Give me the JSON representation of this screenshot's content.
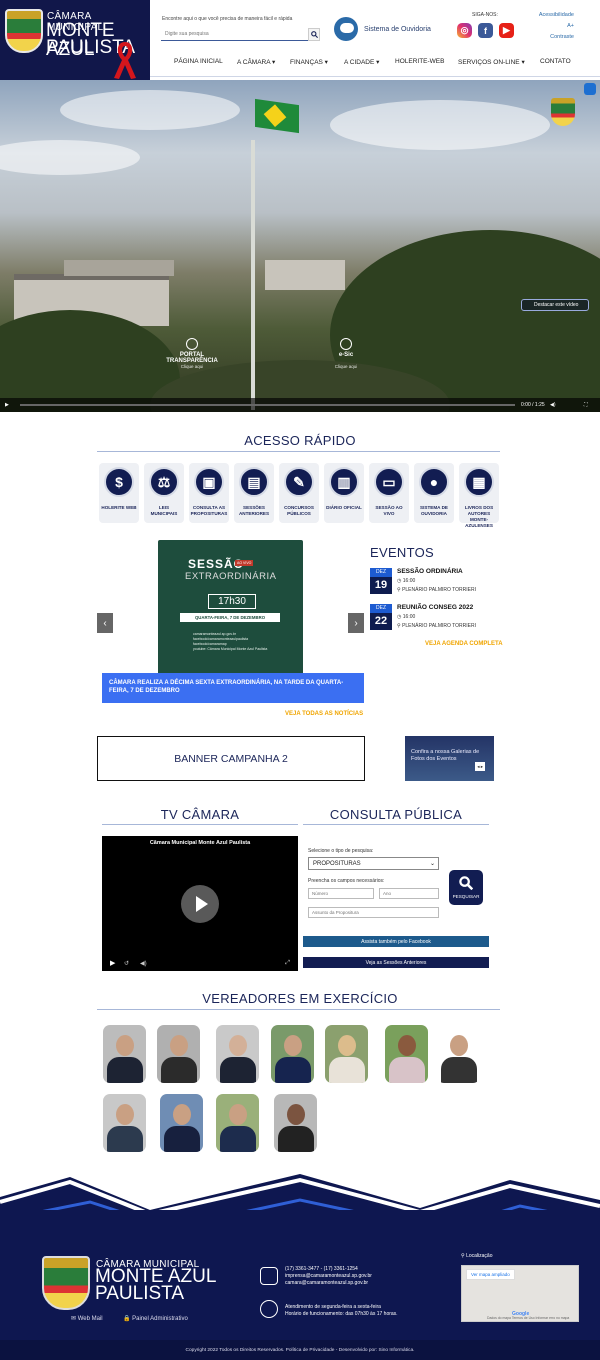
{
  "header": {
    "logo": {
      "line1": "CÂMARA MUNICIPAL",
      "line2": "MONTE AZUL",
      "line3": "PAULISTA"
    },
    "search": {
      "hint": "Encontre aqui o que você precisa de maneira fácil e rápida",
      "placeholder": "Digite sua pesquisa"
    },
    "ouvidoria": "Sistema de Ouvidoria",
    "siga": "SIGA-NOS:",
    "accessibility": {
      "acessibilidade": "Acessibilidade",
      "font_plus": "A+",
      "contraste": "Contraste"
    },
    "nav": [
      "PÁGINA INICIAL",
      "A CÂMARA ▾",
      "FINANÇAS ▾",
      "A CIDADE ▾",
      "HOLERITE-WEB",
      "SERVIÇOS ON-LINE ▾",
      "CONTATO"
    ]
  },
  "hero": {
    "destacar": "Destacar este vídeo",
    "portal": {
      "title1": "PORTAL",
      "title2": "TRANSPARÊNCIA",
      "sub": "Clique aqui"
    },
    "esic": {
      "title": "e-Sic",
      "sub": "Clique aqui"
    },
    "time": "0:00 / 1:25"
  },
  "acesso": {
    "title": "ACESSO RÁPIDO",
    "items": [
      {
        "label": "HOLERITE WEB",
        "icon": "$"
      },
      {
        "label": "LEIS MUNICIPAIS",
        "icon": "⚖"
      },
      {
        "label": "CONSULTA AS PROPOSITURAS",
        "icon": "▣"
      },
      {
        "label": "SESSÕES ANTERIORES",
        "icon": "▤"
      },
      {
        "label": "CONCURSOS PÚBLICOS",
        "icon": "✎"
      },
      {
        "label": "DIÁRIO OFICIAL",
        "icon": "▥"
      },
      {
        "label": "SESSÃO AO VIVO",
        "icon": "▭"
      },
      {
        "label": "SISTEMA DE OUVIDORIA",
        "icon": "●"
      },
      {
        "label": "LIVROS DOS AUTORES MONTE-AZULENSES",
        "icon": "▦"
      }
    ]
  },
  "noticia": {
    "slide": {
      "line1": "SESSÃO",
      "aovivo": "AO VIVO",
      "line2": "EXTRAORDINÁRIA",
      "time": "17h30",
      "date": "QUARTA-FEIRA, 7 DE DEZEMBRO",
      "info": [
        "camaramonteazul.sp.gov.br",
        "facebook/camaramonteazulpaulista",
        "facebook/camaramap",
        "youtube: Câmara Municipal Monte Azul Paulista"
      ]
    },
    "caption": "CÂMARA REALIZA A DÉCIMA SEXTA EXTRAORDINÁRIA, NA TARDE DA QUARTA-FEIRA, 7 DE DEZEMBRO",
    "veja_todas": "VEJA TODAS AS NOTÍCIAS"
  },
  "eventos": {
    "title": "EVENTOS",
    "items": [
      {
        "month": "DEZ",
        "day": "19",
        "title": "SESSÃO ORDINÁRIA",
        "time": "16:00",
        "place": "PLENÁRIO PALMIRO TORRIERI"
      },
      {
        "month": "DEZ",
        "day": "22",
        "title": "REUNIÃO CONSEG 2022",
        "time": "16:00",
        "place": "PLENÁRIO PALMIRO TORRIERI"
      }
    ],
    "agenda": "VEJA AGENDA COMPLETA"
  },
  "banners": {
    "campanha": "BANNER CAMPANHA 2",
    "galeria": "Confira a nossa Galerias de Fotos dos Eventos",
    "galeria_tag": "◂ ▸"
  },
  "tv": {
    "title": "TV CÂMARA",
    "video_title": "Câmara Municipal Monte Azul Paulista"
  },
  "consulta": {
    "title": "CONSULTA PÚBLICA",
    "tipo_label": "Selecione o tipo de pesquisa:",
    "tipo_value": "PROPOSITURAS",
    "campos_label": "Preencha os campos necessários:",
    "numero": "Número",
    "ano": "Ano",
    "assunto": "Assunto da Propositura",
    "pesquisar": "PESQUISAR",
    "facebook": "Assista também pelo Facebook",
    "sessoes": "Veja as Sessões Anteriores",
    "colors": {
      "facebook_btn": "#1d5a8c",
      "sessoes_btn": "#121d52"
    }
  },
  "vereadores": {
    "title": "VEREADORES EM EXERCÍCIO",
    "count": 11
  },
  "footer": {
    "logo": {
      "line1": "CÂMARA MUNICIPAL",
      "line2": "MONTE AZUL",
      "line3": "PAULISTA"
    },
    "webmail": "✉ Web Mail",
    "painel": "🔒 Painel Administrativo",
    "phone": "(17) 3361-3477 - (17) 3361-1254",
    "email1": "imprensa@camaramonteazul.sp.gov.br",
    "email2": "camara@camaramonteazul.sp.gov.br",
    "hours1": "Atendimento de segunda-feira a sexta-feira",
    "hours2": "Horário de funcionamento: das 07h30 às 17 horas.",
    "localizacao": "Localização",
    "map_btn": "Ver mapa ampliado",
    "map_google": "Google",
    "map_footer": "Dados do mapa   Termos de Uso   Informar erro no mapa",
    "copyright": "Copyright 2022 Todos os Direitos Reservados. Política de Privacidade - Desenvolvido por: Sino Informática."
  }
}
